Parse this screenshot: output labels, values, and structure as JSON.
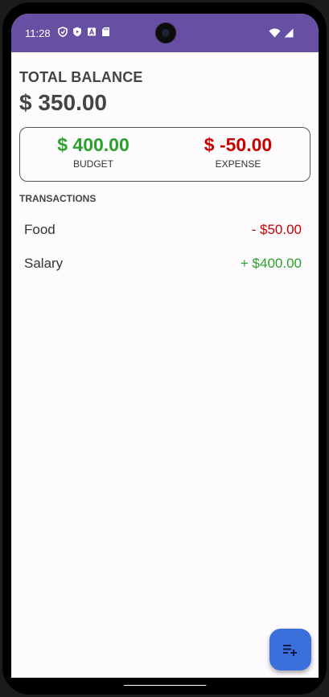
{
  "status": {
    "time": "11:28",
    "left_icons": [
      "shield-icon",
      "play-protect-icon",
      "font-a-icon",
      "sd-card-icon"
    ],
    "right_icons": [
      "wifi-icon",
      "cellular-icon"
    ]
  },
  "balance": {
    "label": "TOTAL BALANCE",
    "value": "$ 350.00"
  },
  "summary": {
    "budget_amount": "$ 400.00",
    "budget_label": "BUDGET",
    "expense_amount": "$ -50.00",
    "expense_label": "EXPENSE",
    "colors": {
      "budget": "#2aa12a",
      "expense": "#c80000"
    }
  },
  "transactions": {
    "header": "TRANSACTIONS",
    "items": [
      {
        "name": "Food",
        "amount": "- $50.00",
        "type": "expense"
      },
      {
        "name": "Salary",
        "amount": "+ $400.00",
        "type": "income"
      }
    ]
  },
  "fab": {
    "icon": "playlist-add-icon",
    "color": "#3a6fdc"
  },
  "theme": {
    "status_bar": "#6750a4"
  }
}
